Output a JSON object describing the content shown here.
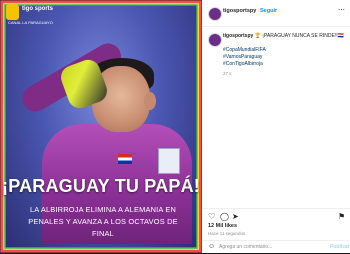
{
  "media": {
    "brand": "tigo sports",
    "brand_sub": "CANAL LA PARAGUAYO",
    "headline": "¡PARAGUAY TU PAPÁ!",
    "subline": "LA ALBIRROJA ELIMINA A ALEMANIA EN PENALES Y AVANZA A LOS OCTAVOS DE FINAL"
  },
  "header": {
    "username": "tigosportspy",
    "separator": "•",
    "follow": "Seguir",
    "more": "⋯"
  },
  "caption": {
    "username": "tigosportspy",
    "text": "🏆 ¡PARAGUAY NUNCA SE RINDE!!🇵🇾",
    "tags": [
      "#CopaMundialFIFA",
      "#VamosParaguay",
      "#ConTigoAlbirroja"
    ],
    "time": "27 s"
  },
  "actions": {
    "like": "♡",
    "comment": "◯",
    "share": "➤",
    "save": "⚑"
  },
  "likes": "12 Mil likes",
  "date": "Hace 11 segundos",
  "comment": {
    "emoji": "☺",
    "placeholder": "Agrega un comentario...",
    "publish": "Publicar"
  },
  "colors": {
    "accent": "#0095f6",
    "jersey": "#8a2f95"
  }
}
